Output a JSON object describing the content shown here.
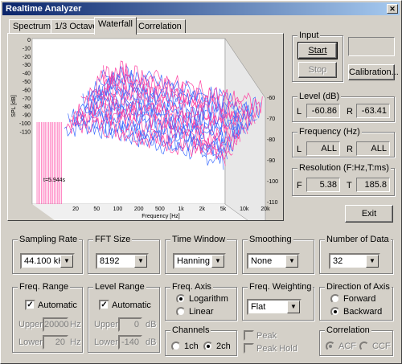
{
  "window": {
    "title": "Realtime Analyzer"
  },
  "tabs": [
    "Spectrum",
    "1/3 Octave",
    "Waterfall",
    "Correlation"
  ],
  "plot": {
    "ylabel": "SPL [dB]",
    "xlabel": "Frequency [Hz]",
    "y_ticks": [
      "0",
      "-10",
      "-20",
      "-30",
      "-40",
      "-50",
      "-60",
      "-70",
      "-80",
      "-90",
      "-100",
      "-110"
    ],
    "right_ticks": [
      "-60",
      "-70",
      "-80",
      "-90",
      "-100",
      "-110"
    ],
    "x_ticks": [
      "20",
      "50",
      "100",
      "200",
      "500",
      "1k",
      "2k",
      "5k",
      "10k",
      "20k"
    ],
    "time_label": "t=5.944s",
    "colors": {
      "trace_a": "#ff3fa0",
      "trace_b": "#3f6fff"
    }
  },
  "input": {
    "title": "Input",
    "start": "Start",
    "stop": "Stop",
    "calibration": "Calibration..."
  },
  "level": {
    "title": "Level (dB)",
    "l_label": "L",
    "l_value": "-60.86",
    "r_label": "R",
    "r_value": "-63.41"
  },
  "frequency": {
    "title": "Frequency (Hz)",
    "l_label": "L",
    "l_value": "ALL",
    "r_label": "R",
    "r_value": "ALL"
  },
  "resolution": {
    "title": "Resolution (F:Hz,T:ms)",
    "f_label": "F",
    "f_value": "5.38",
    "t_label": "T",
    "t_value": "185.8"
  },
  "exit_label": "Exit",
  "sampling_rate": {
    "title": "Sampling Rate",
    "value": "44.100 kHz"
  },
  "fft_size": {
    "title": "FFT Size",
    "value": "8192"
  },
  "time_window": {
    "title": "Time Window",
    "value": "Hanning"
  },
  "smoothing": {
    "title": "Smoothing",
    "value": "None"
  },
  "number_of_data": {
    "title": "Number of Data",
    "value": "32"
  },
  "freq_range": {
    "title": "Freq. Range",
    "automatic": "Automatic",
    "upper_label": "Upper",
    "upper_value": "20000",
    "upper_unit": "Hz",
    "lower_label": "Lower",
    "lower_value": "20",
    "lower_unit": "Hz"
  },
  "level_range": {
    "title": "Level Range",
    "automatic": "Automatic",
    "upper_label": "Upper",
    "upper_value": "0",
    "upper_unit": "dB",
    "lower_label": "Lower",
    "lower_value": "-140",
    "lower_unit": "dB"
  },
  "freq_axis": {
    "title": "Freq. Axis",
    "logarithm": "Logarithm",
    "linear": "Linear"
  },
  "channels": {
    "title": "Channels",
    "ch1": "1ch",
    "ch2": "2ch"
  },
  "freq_weighting": {
    "title": "Freq. Weighting",
    "value": "Flat",
    "peak": "Peak",
    "peak_hold": "Peak Hold"
  },
  "direction_of_axis": {
    "title": "Direction of Axis",
    "forward": "Forward",
    "backward": "Backward"
  },
  "correlation": {
    "title": "Correlation",
    "acf": "ACF",
    "ccf": "CCF"
  }
}
